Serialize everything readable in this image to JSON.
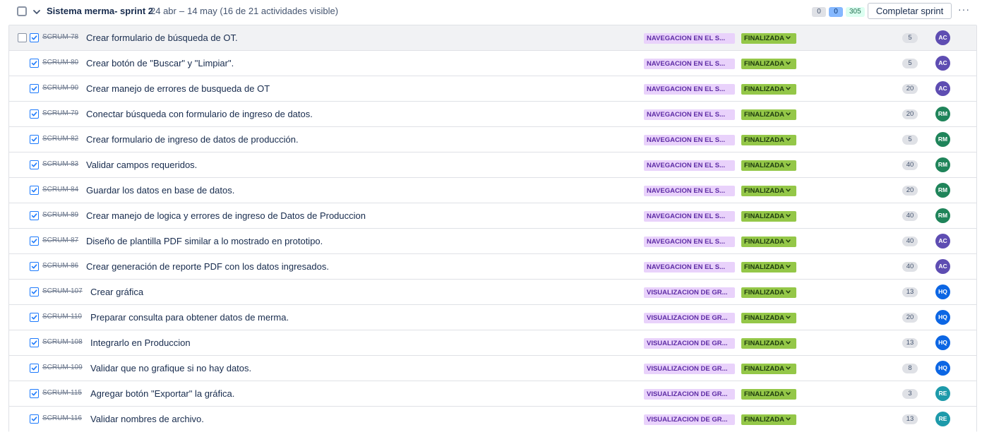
{
  "sprint": {
    "title": "Sistema merma- sprint 2",
    "date_start": "24 abr",
    "date_sep": "–",
    "date_end": "14 may",
    "visible_summary": "(16 de 21 actividades visible)",
    "counts": {
      "todo": "0",
      "in_progress": "0",
      "done": "305"
    },
    "complete_button": "Completar sprint",
    "more_label": "···"
  },
  "colors": {
    "AC": "#5e4db2",
    "RM": "#1f845a",
    "HQ": "#0c66e4",
    "RE": "#1d9aaa"
  },
  "issues": [
    {
      "key": "SCRUM-78",
      "summary": "Crear formulario de búsqueda de OT.",
      "epic": "NAVEGACION EN EL S...",
      "status": "FINALIZADA",
      "points": "5",
      "assignee": "AC"
    },
    {
      "key": "SCRUM-80",
      "summary": "Crear botón de \"Buscar\" y \"Limpiar\".",
      "epic": "NAVEGACION EN EL S...",
      "status": "FINALIZADA",
      "points": "5",
      "assignee": "AC"
    },
    {
      "key": "SCRUM-90",
      "summary": "Crear manejo de errores de busqueda de OT",
      "epic": "NAVEGACION EN EL S...",
      "status": "FINALIZADA",
      "points": "20",
      "assignee": "AC"
    },
    {
      "key": "SCRUM-79",
      "summary": "Conectar búsqueda con formulario de ingreso de datos.",
      "epic": "NAVEGACION EN EL S...",
      "status": "FINALIZADA",
      "points": "20",
      "assignee": "RM"
    },
    {
      "key": "SCRUM-82",
      "summary": "Crear formulario de ingreso de datos de producción.",
      "epic": "NAVEGACION EN EL S...",
      "status": "FINALIZADA",
      "points": "5",
      "assignee": "RM"
    },
    {
      "key": "SCRUM-83",
      "summary": "Validar campos requeridos.",
      "epic": "NAVEGACION EN EL S...",
      "status": "FINALIZADA",
      "points": "40",
      "assignee": "RM"
    },
    {
      "key": "SCRUM-84",
      "summary": "Guardar los datos en base de datos.",
      "epic": "NAVEGACION EN EL S...",
      "status": "FINALIZADA",
      "points": "20",
      "assignee": "RM"
    },
    {
      "key": "SCRUM-89",
      "summary": "Crear manejo de logica y errores de ingreso de Datos de Produccion",
      "epic": "NAVEGACION EN EL S...",
      "status": "FINALIZADA",
      "points": "40",
      "assignee": "RM"
    },
    {
      "key": "SCRUM-87",
      "summary": "Diseño de plantilla PDF similar a lo mostrado en prototipo.",
      "epic": "NAVEGACION EN EL S...",
      "status": "FINALIZADA",
      "points": "40",
      "assignee": "AC"
    },
    {
      "key": "SCRUM-86",
      "summary": "Crear generación de reporte PDF con los datos ingresados.",
      "epic": "NAVEGACION EN EL S...",
      "status": "FINALIZADA",
      "points": "40",
      "assignee": "AC"
    },
    {
      "key": "SCRUM-107",
      "summary": "Crear gráfica",
      "epic": "VISUALIZACION DE GR...",
      "status": "FINALIZADA",
      "points": "13",
      "assignee": "HQ"
    },
    {
      "key": "SCRUM-110",
      "summary": "Preparar consulta para obtener datos de merma.",
      "epic": "VISUALIZACION DE GR...",
      "status": "FINALIZADA",
      "points": "20",
      "assignee": "HQ"
    },
    {
      "key": "SCRUM-108",
      "summary": "Integrarlo en Produccion",
      "epic": "VISUALIZACION DE GR...",
      "status": "FINALIZADA",
      "points": "13",
      "assignee": "HQ"
    },
    {
      "key": "SCRUM-109",
      "summary": "Validar que no grafique si no hay datos.",
      "epic": "VISUALIZACION DE GR...",
      "status": "FINALIZADA",
      "points": "8",
      "assignee": "HQ"
    },
    {
      "key": "SCRUM-115",
      "summary": "Agregar botón \"Exportar\" la gráfica.",
      "epic": "VISUALIZACION DE GR...",
      "status": "FINALIZADA",
      "points": "3",
      "assignee": "RE"
    },
    {
      "key": "SCRUM-116",
      "summary": "Validar nombres de archivo.",
      "epic": "VISUALIZACION DE GR...",
      "status": "FINALIZADA",
      "points": "13",
      "assignee": "RE"
    }
  ]
}
